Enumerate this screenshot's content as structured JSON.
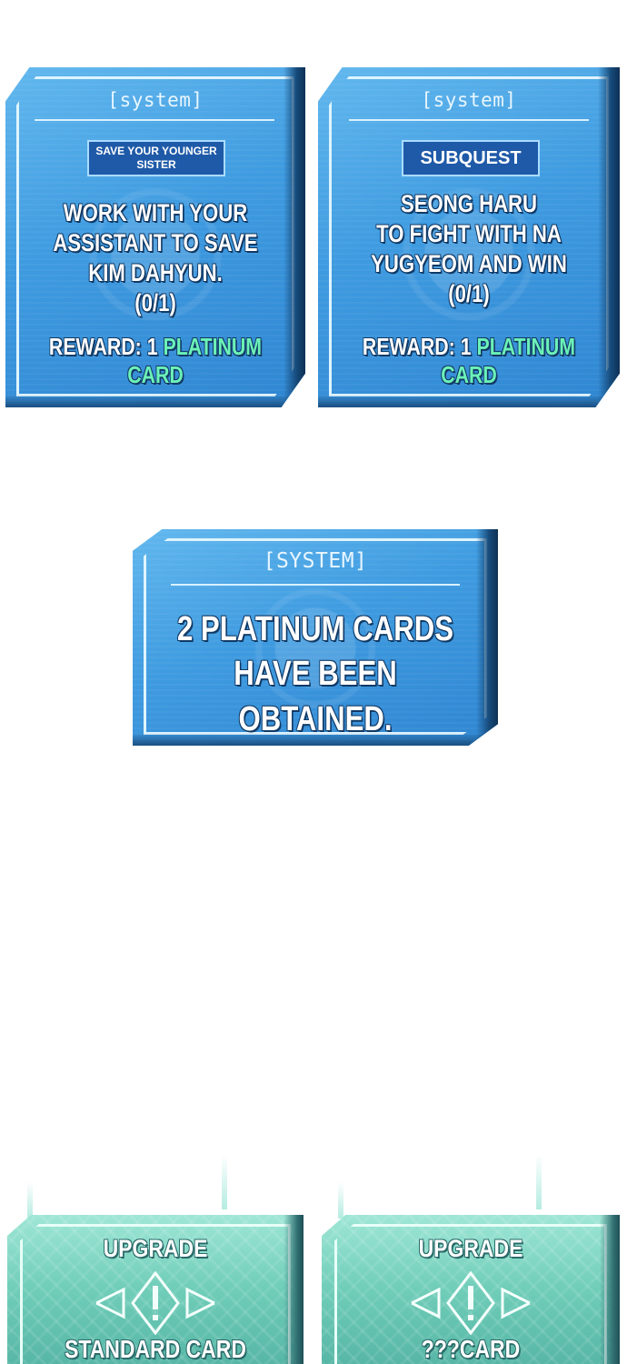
{
  "panel_left": {
    "title": "[system]",
    "tag": "SAVE YOUR YOUNGER SISTER",
    "lines": [
      "WORK WITH YOUR",
      "ASSISTANT TO SAVE",
      "KIM DAHYUN.",
      "(0/1)"
    ],
    "reward_prefix": "REWARD: 1 ",
    "reward_item": "PLATINUM CARD"
  },
  "panel_right": {
    "title": "[system]",
    "tag": "SUBQUEST",
    "lines": [
      "SEONG HARU",
      "TO FIGHT WITH NA",
      "YUGYEOM AND WIN",
      "(0/1)"
    ],
    "reward_prefix": "REWARD: 1 ",
    "reward_item": "PLATINUM CARD"
  },
  "panel_center": {
    "title": "[SYSTEM]",
    "lines": [
      "2 PLATINUM CARDS",
      "HAVE BEEN OBTAINED."
    ]
  },
  "upgrade_left": {
    "title": "UPGRADE",
    "emblem_icon": "exclamation-diamond-icon",
    "card": "STANDARD CARD"
  },
  "upgrade_right": {
    "title": "UPGRADE",
    "emblem_icon": "exclamation-diamond-icon",
    "card": "???CARD"
  },
  "colors": {
    "system_blue": "#3f9be0",
    "highlight_green": "#6cf2b8",
    "upgrade_teal": "#6fcdb8"
  }
}
